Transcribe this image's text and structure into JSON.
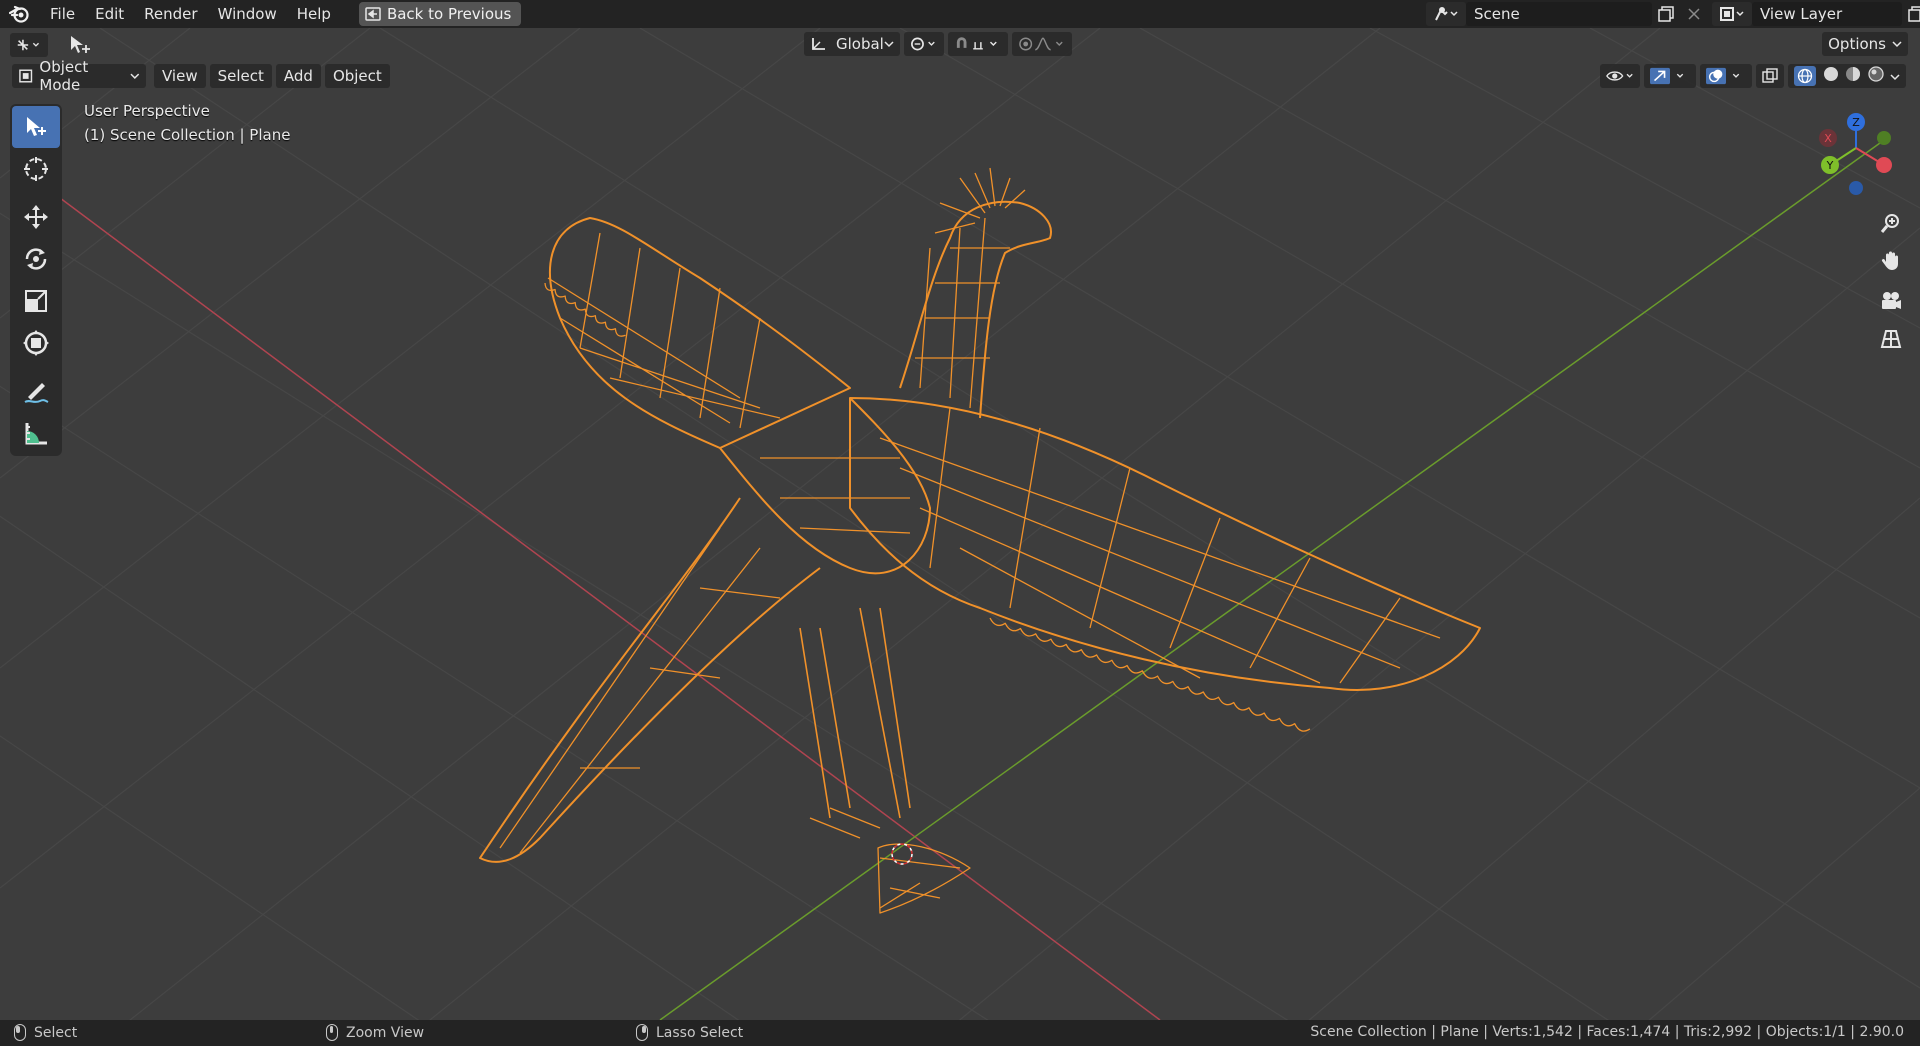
{
  "menu": {
    "items": [
      "File",
      "Edit",
      "Render",
      "Window",
      "Help"
    ],
    "back_button": "Back to Previous"
  },
  "scene": {
    "name": "Scene",
    "view_layer": "View Layer"
  },
  "tool_header": {
    "orientation": "Global",
    "options": "Options"
  },
  "viewport_header": {
    "mode": "Object Mode",
    "menus": [
      "View",
      "Select",
      "Add",
      "Object"
    ]
  },
  "overlay": {
    "view_name": "User Perspective",
    "collection_info": "(1) Scene Collection | Plane"
  },
  "gizmo": {
    "x_label": "X",
    "y_label": "Y",
    "z_label": "Z"
  },
  "status": {
    "select": "Select",
    "zoom": "Zoom View",
    "lasso": "Lasso Select",
    "stats": "Scene Collection | Plane | Verts:1,542 | Faces:1,474 | Tris:2,992 | Objects:1/1 | 2.90.0"
  },
  "icons": {
    "tools": [
      "select-box-icon",
      "cursor-icon",
      "move-icon",
      "rotate-icon",
      "scale-icon",
      "transform-icon",
      "annotate-icon",
      "measure-icon"
    ],
    "nav": [
      "zoom-icon",
      "pan-hand-icon",
      "camera-icon",
      "grid-ortho-icon"
    ]
  },
  "colors": {
    "accent": "#4772b3",
    "wireframe": "#f0912a",
    "x_axis": "#c0404c",
    "y_axis": "#6a9c2c",
    "grid_bg": "#3d3d3d"
  }
}
